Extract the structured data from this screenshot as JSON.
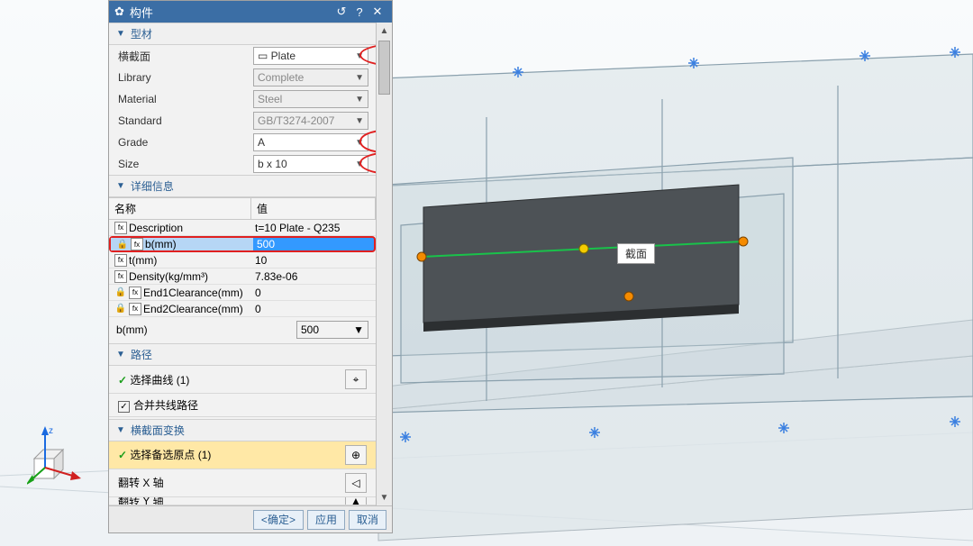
{
  "panel": {
    "title": "构件",
    "sections": {
      "profile": {
        "header": "型材",
        "fields": {
          "cross_section": {
            "label": "横截面",
            "value": "Plate",
            "highlighted": true
          },
          "library": {
            "label": "Library",
            "value": "Complete",
            "disabled": true
          },
          "material": {
            "label": "Material",
            "value": "Steel",
            "disabled": true
          },
          "standard": {
            "label": "Standard",
            "value": "GB/T3274-2007",
            "disabled": true
          },
          "grade": {
            "label": "Grade",
            "value": "A",
            "highlighted": true
          },
          "size": {
            "label": "Size",
            "value": "b x 10",
            "highlighted": true
          }
        }
      },
      "details": {
        "header": "详细信息",
        "columns": {
          "name": "名称",
          "value": "值"
        },
        "rows": [
          {
            "name": "Description",
            "value": "t=10 Plate - Q235",
            "icon": "calc"
          },
          {
            "name": "b(mm)",
            "value": "500",
            "icon": "lock-calc",
            "selected": true,
            "highlighted": true
          },
          {
            "name": "t(mm)",
            "value": "10",
            "icon": "calc"
          },
          {
            "name": "Density(kg/mm³)",
            "value": "7.83e-06",
            "icon": "calc"
          },
          {
            "name": "End1Clearance(mm)",
            "value": "0",
            "icon": "lock-calc"
          },
          {
            "name": "End2Clearance(mm)",
            "value": "0",
            "icon": "lock-calc"
          }
        ],
        "footer": {
          "label": "b(mm)",
          "value": "500"
        }
      },
      "path": {
        "header": "路径",
        "select_curve": {
          "label": "选择曲线 (1)",
          "checked": true
        },
        "merge": {
          "label": "合并共线路径",
          "checked": true
        }
      },
      "xform": {
        "header": "横截面变换",
        "select_origin": {
          "label": "选择备选原点 (1)",
          "selected": true
        },
        "flip_x": "翻转 X 轴",
        "flip_y": "翻转 Y 轴"
      }
    }
  },
  "footer": {
    "ok": "确定",
    "apply": "应用",
    "cancel": "取消"
  },
  "viewport": {
    "tooltip": "截面"
  }
}
